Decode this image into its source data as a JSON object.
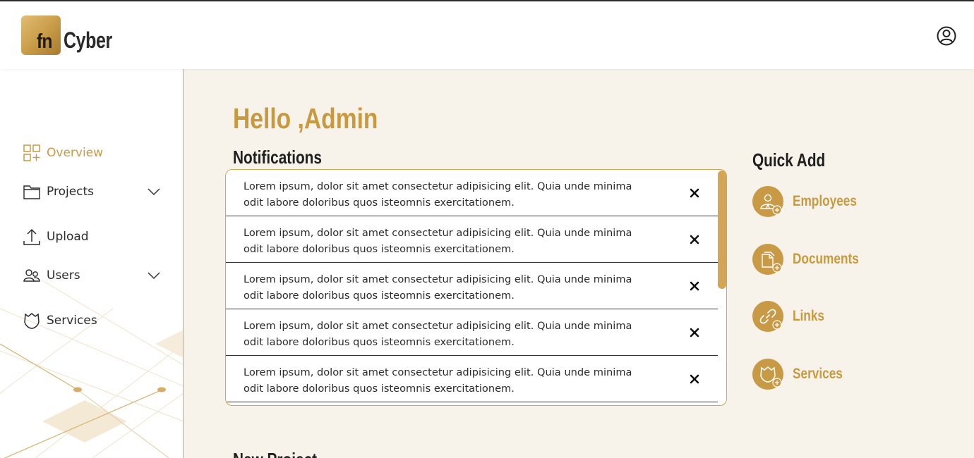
{
  "app": {
    "logo_fn": "fn",
    "logo_name": "Cyber"
  },
  "colors": {
    "accent": "#c89a46",
    "background": "#f8f3ea",
    "text": "#2b2b2b"
  },
  "header": {
    "user_icon": "user-circle-icon"
  },
  "sidebar": {
    "items": [
      {
        "label": "Overview",
        "icon": "overview-grid-icon",
        "active": true
      },
      {
        "label": "Projects",
        "icon": "folder-icon",
        "expandable": true
      },
      {
        "label": "Upload",
        "icon": "upload-icon"
      },
      {
        "label": "Users",
        "icon": "users-icon",
        "expandable": true
      },
      {
        "label": "Services",
        "icon": "shield-icon"
      }
    ]
  },
  "main": {
    "greeting": "Hello ,Admin",
    "notifications_title": "Notifications",
    "notifications": [
      {
        "line1": "Lorem ipsum, dolor sit amet consectetur adipisicing elit. Quia unde minima",
        "line2": "odit labore doloribus quos isteomnis exercitationem."
      },
      {
        "line1": "Lorem ipsum, dolor sit amet consectetur adipisicing elit. Quia unde minima",
        "line2": "odit labore doloribus quos isteomnis exercitationem."
      },
      {
        "line1": "Lorem ipsum, dolor sit amet consectetur adipisicing elit. Quia unde minima",
        "line2": "odit labore doloribus quos isteomnis exercitationem."
      },
      {
        "line1": "Lorem ipsum, dolor sit amet consectetur adipisicing elit. Quia unde minima",
        "line2": "odit labore doloribus quos isteomnis exercitationem."
      },
      {
        "line1": "Lorem ipsum, dolor sit amet consectetur adipisicing elit. Quia unde minima",
        "line2": "odit labore doloribus quos isteomnis exercitationem."
      }
    ],
    "close_icon": "close-icon",
    "next_section_title": "New Project"
  },
  "quick_add": {
    "title": "Quick Add",
    "items": [
      {
        "label": "Employees",
        "icon": "add-employee-icon"
      },
      {
        "label": "Documents",
        "icon": "add-document-icon"
      },
      {
        "label": "Links",
        "icon": "add-link-icon"
      },
      {
        "label": "Services",
        "icon": "add-service-icon"
      }
    ]
  }
}
